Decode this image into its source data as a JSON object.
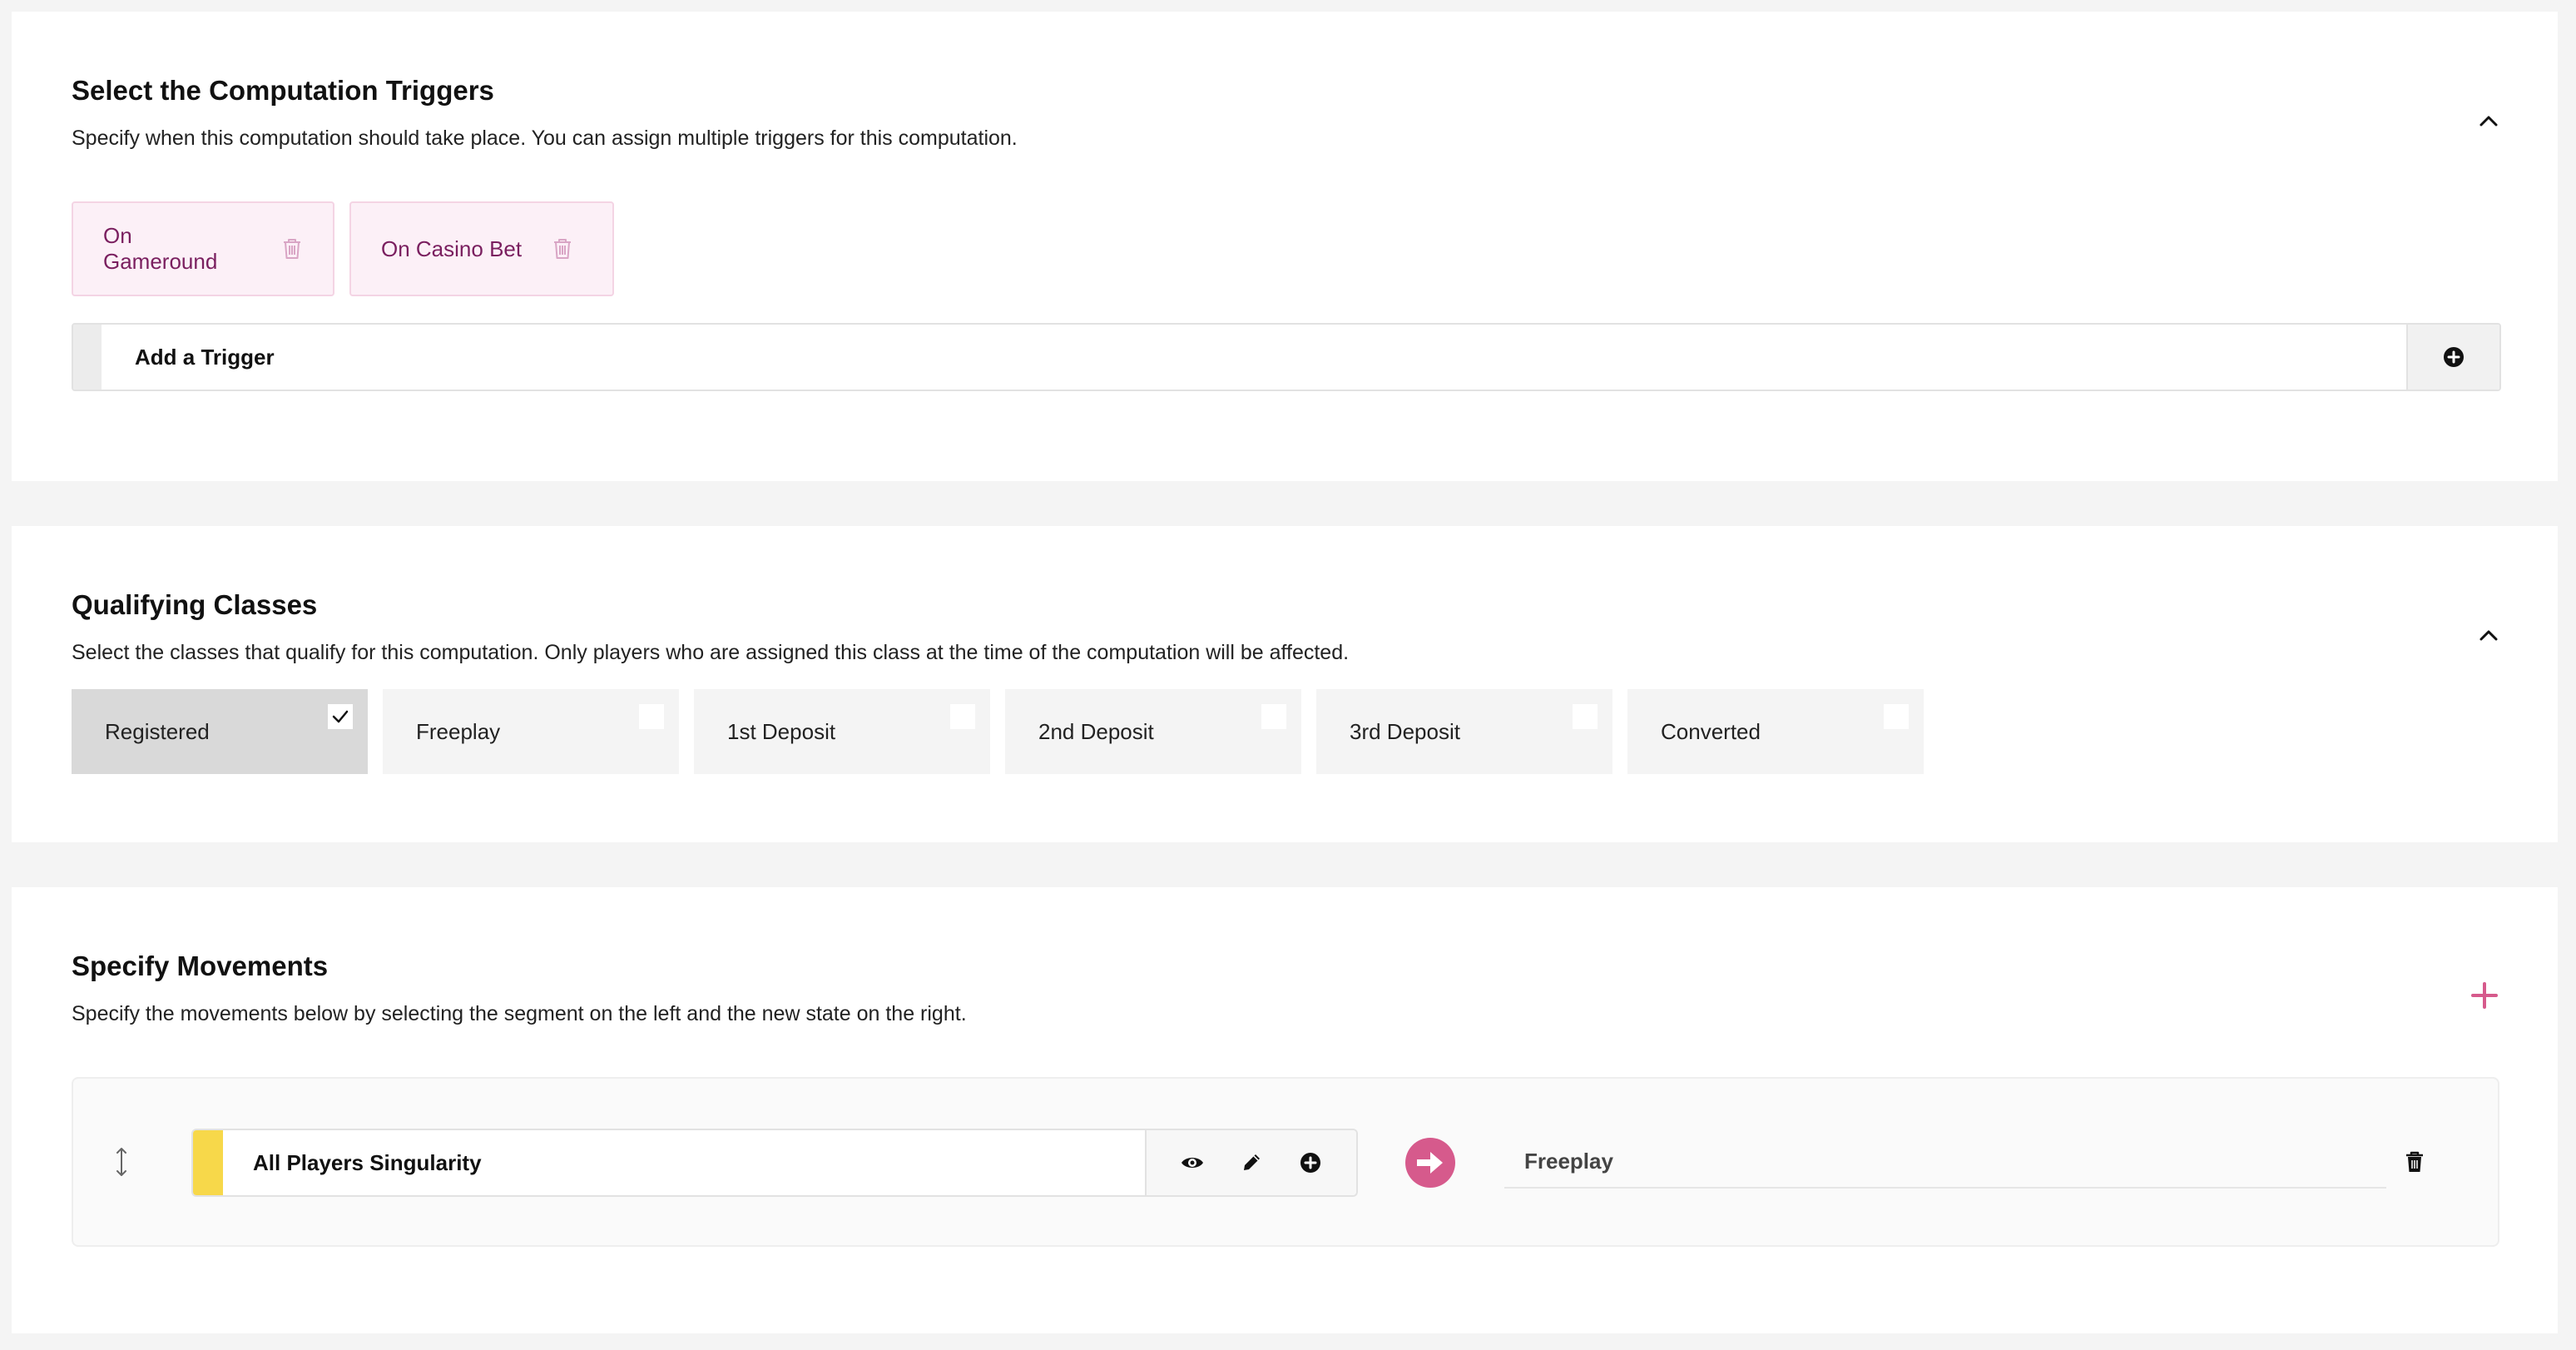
{
  "triggers": {
    "title": "Select the Computation Triggers",
    "description": "Specify when this computation should take place. You can assign multiple triggers for this computation.",
    "items": [
      {
        "label": "On Gameround"
      },
      {
        "label": "On Casino Bet"
      }
    ],
    "add_label": "Add a Trigger",
    "icons": {
      "collapse": "chevron-up-icon",
      "remove": "trash-icon",
      "add": "plus-circle-icon"
    }
  },
  "classes": {
    "title": "Qualifying Classes",
    "description": "Select the classes that qualify for this computation. Only players who are assigned this class at the time of the computation will be affected.",
    "items": [
      {
        "label": "Registered",
        "checked": true
      },
      {
        "label": "Freeplay",
        "checked": false
      },
      {
        "label": "1st Deposit",
        "checked": false
      },
      {
        "label": "2nd Deposit",
        "checked": false
      },
      {
        "label": "3rd Deposit",
        "checked": false
      },
      {
        "label": "Converted",
        "checked": false
      }
    ]
  },
  "movements": {
    "title": "Specify Movements",
    "description": "Specify the movements below by selecting the segment on the left and the new state on the right.",
    "rows": [
      {
        "segment": "All Players Singularity",
        "segment_color": "#f7d84a",
        "target": "Freeplay"
      }
    ],
    "icons": {
      "add": "plus-icon",
      "drag": "drag-handle-icon",
      "view": "eye-icon",
      "edit": "pencil-icon",
      "add_segment": "plus-circle-icon",
      "arrow": "arrow-right-circle-icon",
      "delete": "trash-icon"
    }
  },
  "colors": {
    "accent": "#d65a8c",
    "chip_bg": "#fcf0f7",
    "chip_text": "#7a1f5f",
    "chip_icon": "#d9a5c5"
  }
}
